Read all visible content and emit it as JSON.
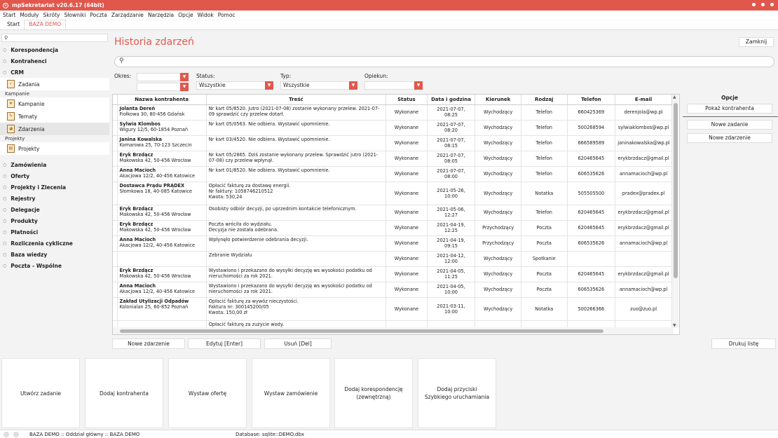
{
  "app": {
    "title": "mpSekretariat v20.6.17 (64bit)"
  },
  "menu": [
    "Start",
    "Moduły",
    "Skróty",
    "Słowniki",
    "Poczta",
    "Zarządzanie",
    "Narzędzia",
    "Opcje",
    "Widok",
    "Pomoc"
  ],
  "tabs": [
    "Start",
    "BAZA DEMO"
  ],
  "sidebar": {
    "top_sections": [
      "Korespondencja",
      "Kontrahenci",
      "CRM"
    ],
    "crm_first": "Zadania",
    "group_kampanie": "Kampanie",
    "kampanie_items": [
      "Kampanie",
      "Tematy",
      "Zdarzenia"
    ],
    "group_projekty": "Projekty",
    "projekty_items": [
      "Projekty"
    ],
    "bottom_sections": [
      "Zamówienia",
      "Oferty",
      "Projekty i Zlecenia",
      "Rejestry",
      "Delegacje",
      "Produkty",
      "Płatności",
      "Rozliczenia cykliczne",
      "Baza wiedzy",
      "Poczta - Wspólne"
    ]
  },
  "main": {
    "title": "Historia zdarzeń",
    "close": "Zamknij",
    "filters": {
      "okres": "Okres:",
      "status": "Status:",
      "status_value": "Wszystkie",
      "typ": "Typ:",
      "typ_value": "Wszystkie",
      "opiekun": "Opiekun:"
    }
  },
  "table": {
    "headers": [
      "Nazwa kontrahenta",
      "Treść",
      "Status",
      "Data i godzina",
      "Kierunek",
      "Rodzaj",
      "Telefon",
      "E-mail"
    ],
    "rows": [
      {
        "name": "Jolanta Dereń",
        "addr": "Fiołkowa 30, 80-456 Gdańsk",
        "text": "Nr kart 05/8520. Jutro (2021-07-08) zostanie wykonany przelew. 2021-07-09 sprawdzić czy przelew dotarł.",
        "status": "Wykonane",
        "date": "2021-07-07,\n08:25",
        "dir": "Wychodzący",
        "kind": "Telefon",
        "phone": "660425369",
        "email": "derenjola@wp.pl"
      },
      {
        "name": "Sylwia Klombos",
        "addr": "Wigury 12/5, 60-1854 Poznań",
        "text": "Nr kart 05/0563. Nie odbiera. Wystawić upomnienie.",
        "status": "Wykonane",
        "date": "2021-07-07,\n08:20",
        "dir": "Wychodzący",
        "kind": "Telefon",
        "phone": "500268594",
        "email": "sylwiaklombos@wp.pl"
      },
      {
        "name": "Janina Kowalska",
        "addr": "Komarowa 25, 70-123 Szczecin",
        "text": "Nr kart 03/4520. Nie odbiera. Wystawić upomnienie.",
        "status": "Wykonane",
        "date": "2021-07-07,\n08:15",
        "dir": "Wychodzący",
        "kind": "Telefon",
        "phone": "666589589",
        "email": "janinakowalska@wp.pl"
      },
      {
        "name": "Eryk Brzdącz",
        "addr": "Makowska 42, 50-456 Wrocław",
        "text": "Nr kart 05/2865. Dziś zostanie wykonany przelew. Sprawdzić jutro (2021-07-08) czy przelew wpłynął.",
        "status": "Wykonane",
        "date": "2021-07-07,\n08:05",
        "dir": "Wychodzący",
        "kind": "Telefon",
        "phone": "620465645",
        "email": "erykbrzdacz@gmail.pl"
      },
      {
        "name": "Anna Macioch",
        "addr": "Akacjowa 12/2, 40-456 Katowice",
        "text": "Nr kart 01/8520. Nie odbiera. Wystawić upomnienie.",
        "status": "Wykonane",
        "date": "2021-07-07,\n08:00",
        "dir": "Wychodzący",
        "kind": "Telefon",
        "phone": "606535626",
        "email": "annamacioch@wp.pl"
      },
      {
        "name": "Dostawca Prądu PRĄDEX",
        "addr": "Słomkowa 18, 40-085 Katowice",
        "text": "Opłacić fakturę za dostawę energii.\nNr faktury: 1058746210512\nKwota: 530,24",
        "status": "Wykonane",
        "date": "2021-05-26,\n10:00",
        "dir": "Wychodzący",
        "kind": "Notatka",
        "phone": "505505500",
        "email": "pradex@pradex.pl"
      },
      {
        "name": "Eryk Brzdącz",
        "addr": "Makowska 42, 50-456 Wrocław",
        "text": "Osobisty odbiór decyzji, po uprzednim kontakcie telefonicznym.",
        "status": "Wykonane",
        "date": "2021-05-06,\n12:27",
        "dir": "Wychodzący",
        "kind": "Telefon",
        "phone": "620465645",
        "email": "erykbrzdacz@gmail.pl"
      },
      {
        "name": "Eryk Brzdącz",
        "addr": "Makowska 42, 50-456 Wrocław",
        "text": "Poczta wróciła do wydziału.\nDecyzja nie została odebrana.",
        "status": "Wykonane",
        "date": "2021-04-19,\n12:25",
        "dir": "Przychodzący",
        "kind": "Poczta",
        "phone": "620465645",
        "email": "erykbrzdacz@gmail.pl"
      },
      {
        "name": "Anna Macioch",
        "addr": "Akacjowa 12/2, 40-456 Katowice",
        "text": "Wpłynęło potwierdzenie odebrania decyzji.",
        "status": "Wykonane",
        "date": "2021-04-19,\n09:15",
        "dir": "Przychodzący",
        "kind": "Poczta",
        "phone": "606535626",
        "email": "annamacioch@wp.pl"
      },
      {
        "name": "",
        "addr": "",
        "text": "Zebranie Wydziału",
        "status": "Wykonane",
        "date": "2021-04-12,\n12:00",
        "dir": "Wychodzący",
        "kind": "Spotkanie",
        "phone": "",
        "email": ""
      },
      {
        "name": "Eryk Brzdącz",
        "addr": "Makowska 42, 50-456 Wrocław",
        "text": "Wystawiono i przekazano do wysyłki decyzję ws wysokości podatku od nieruchomości za rok 2021.",
        "status": "Wykonane",
        "date": "2021-04-05,\n11:25",
        "dir": "Wychodzący",
        "kind": "Poczta",
        "phone": "620465645",
        "email": "erykbrzdacz@gmail.pl"
      },
      {
        "name": "Anna Macioch",
        "addr": "Akacjowa 12/2, 40-456 Katowice",
        "text": "Wystawiono i przekazano do wysyłki decyzję ws wysokości podatku od nieruchomości za rok 2021.",
        "status": "Wykonane",
        "date": "2021-04-05,\n10:00",
        "dir": "Wychodzący",
        "kind": "Poczta",
        "phone": "606535626",
        "email": "annamacioch@wp.pl"
      },
      {
        "name": "Zakład Utylizacji Odpadów",
        "addr": "Kolonialan 25, 60-852 Poznań",
        "text": "Opłacić fakturę za wywóz nieczystości.\nFaktura nr: 300145200/05\nKwota: 150,00 zł",
        "status": "Wykonane",
        "date": "2021-03-11,\n10:00",
        "dir": "Wychodzący",
        "kind": "Notatka",
        "phone": "500266366",
        "email": "zuo@zuo.pl"
      },
      {
        "name": "",
        "addr": "",
        "text": "Opłacić fakturę za zużycie wody.",
        "status": "",
        "date": "",
        "dir": "",
        "kind": "",
        "phone": "",
        "email": ""
      }
    ]
  },
  "options": {
    "title": "Opcje",
    "show_contractor": "Pokaż kontrahenta",
    "new_task": "Nowe zadanie",
    "new_event": "Nowe zdarzenie"
  },
  "actions": {
    "new_event": "Nowe zdarzenie",
    "edit": "Edytuj [Enter]",
    "delete": "Usuń [Del]",
    "print": "Drukuj listę"
  },
  "tiles": [
    "Utwórz zadanie",
    "Dodaj kontrahenta",
    "Wystaw ofertę",
    "Wystaw zamówienie",
    "Dodaj korespondencję\n(zewnętrzną)",
    "Dodaj przyciski\nSzybkiego uruchamiania"
  ],
  "status": {
    "left": "BAZA DEMO :: Oddział główny :: BAZA DEMO",
    "db": "Database: sqlite::DEMO.dbx"
  }
}
